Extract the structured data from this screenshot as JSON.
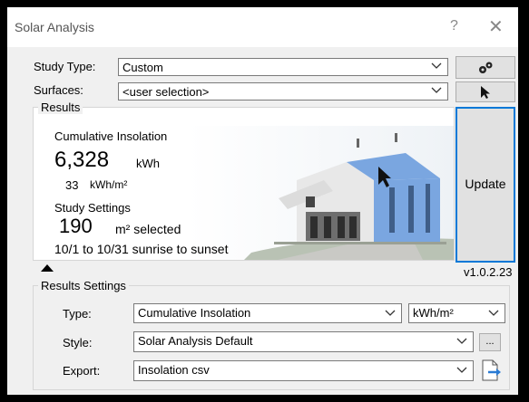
{
  "window": {
    "title": "Solar Analysis",
    "help_glyph": "?",
    "close_glyph": "✕"
  },
  "study": {
    "type_label": "Study Type:",
    "type_value": "Custom",
    "surfaces_label": "Surfaces:",
    "surfaces_value": "<user selection>"
  },
  "results": {
    "legend": "Results",
    "heading": "Cumulative Insolation",
    "total_value": "6,328",
    "total_unit": "kWh",
    "per_area_value": "33",
    "per_area_unit": "kWh/m²",
    "settings_heading": "Study Settings",
    "area_value": "190",
    "area_unit": "m² selected",
    "date_range": "10/1 to 10/31 sunrise to sunset"
  },
  "update_label": "Update",
  "version": "v1.0.2.23",
  "results_settings": {
    "legend": "Results Settings",
    "type_label": "Type:",
    "type_value": "Cumulative Insolation",
    "unit_value": "kWh/m²",
    "style_label": "Style:",
    "style_value": "Solar Analysis Default",
    "more_label": "...",
    "export_label": "Export:",
    "export_value": "Insolation csv"
  },
  "colors": {
    "accent": "#0078d7",
    "panel_blue": "#7aa6e0"
  }
}
